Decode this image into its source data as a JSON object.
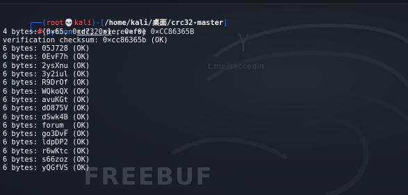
{
  "terminal": {
    "prompt": {
      "box_top": "┌──(",
      "user": "root",
      "skull": "💀",
      "host": "kali",
      "close_user": ")-[",
      "path": "/home/kali/桌面/crc32-master",
      "close_path": "]",
      "box_bottom": "└─",
      "hash": "#"
    },
    "command": {
      "program": "python",
      "file": "crc32.py",
      "args": "reverse 0×CC86365B"
    },
    "output_lines": [
      "4 bytes: {0×65, 0×d7, 0×1e, 0×f0}",
      "verification checksum: 0×cc86365b (OK)",
      "6 bytes: 05J728 (OK)",
      "6 bytes: 0EvF7h (OK)",
      "6 bytes: 2ysXnu (OK)",
      "6 bytes: 3y2iul (OK)",
      "6 bytes: R9DrOf (OK)",
      "6 bytes: WQkoQX (OK)",
      "6 bytes: avuKGt (OK)",
      "6 bytes: dO875V (OK)",
      "6 bytes: dSwk4B (OK)",
      "6 bytes: forum_ (OK)",
      "6 bytes: go3DvF (OK)",
      "6 bytes: ldpDP2 (OK)",
      "6 bytes: r6wKtc (OK)",
      "6 bytes: s66zoz (OK)",
      "6 bytes: yQGfVS (OK)"
    ]
  },
  "background": {
    "watermark_text": "t.me/seccodin",
    "brand_watermark": "FREEBUF"
  },
  "colors": {
    "background": "#1b1f27",
    "prompt_frame": "#2f73ff",
    "root_and_host": "#ff4b5c",
    "path": "#f3f5f7",
    "command": "#4f9cff",
    "output": "#eef1f5"
  }
}
